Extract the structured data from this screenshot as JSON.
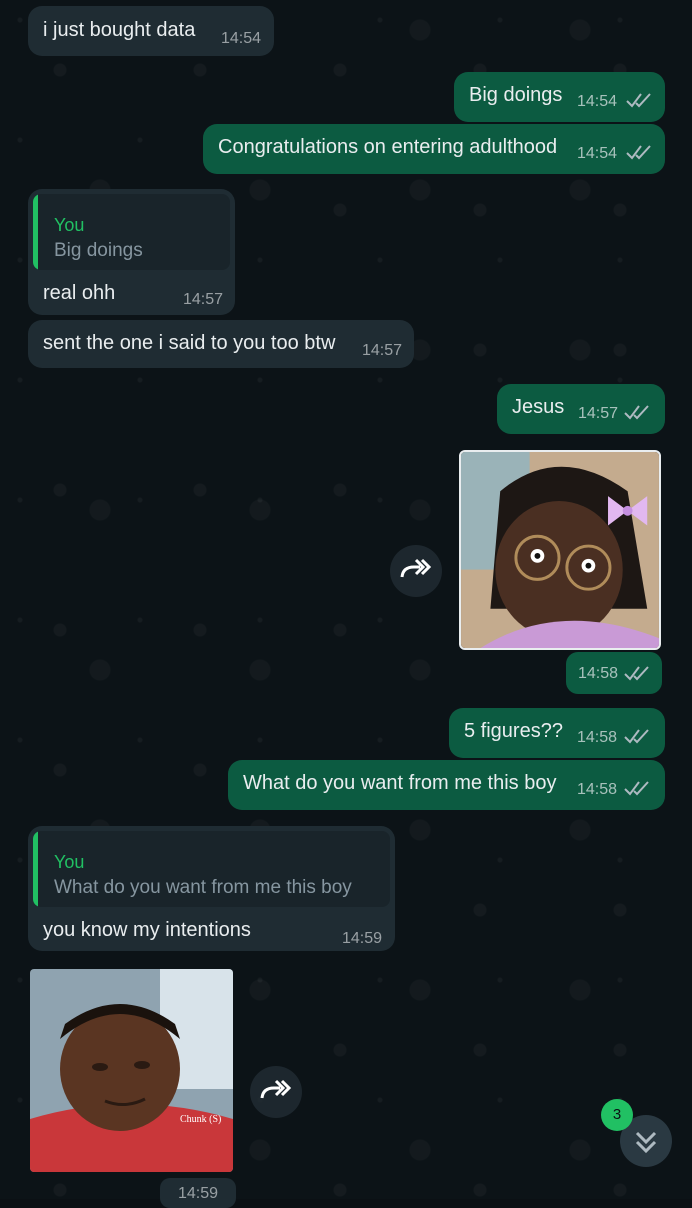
{
  "messages": [
    {
      "dir": "in",
      "text": "i just bought data",
      "time": "14:54"
    },
    {
      "dir": "out",
      "text": "Big doings",
      "time": "14:54"
    },
    {
      "dir": "out",
      "text": "Congratulations on entering adulthood",
      "time": "14:54"
    },
    {
      "dir": "in",
      "quote_author": "You",
      "quote_text": "Big doings",
      "text": "real ohh",
      "time": "14:57"
    },
    {
      "dir": "in",
      "text": "sent the one i said to you too btw",
      "time": "14:57"
    },
    {
      "dir": "out",
      "text": "Jesus",
      "time": "14:57"
    },
    {
      "dir": "out",
      "type": "image",
      "image_desc": "girl-with-glasses-meme",
      "time": "14:58"
    },
    {
      "dir": "out",
      "text": "5 figures??",
      "time": "14:58"
    },
    {
      "dir": "out",
      "text": "What do you want from me this boy",
      "time": "14:58"
    },
    {
      "dir": "in",
      "quote_author": "You",
      "quote_text": "What do you want from me this boy",
      "text": "you know my intentions",
      "time": "14:59"
    },
    {
      "dir": "in",
      "type": "image",
      "image_desc": "boy-meme",
      "image_caption": "Chunk (S)",
      "time": "14:59"
    }
  ],
  "unread_count": "3",
  "colors": {
    "incoming": "#1f2c33",
    "outgoing": "#0c5b41",
    "accent": "#21c063",
    "ticks": "#8696a0"
  },
  "icons": {
    "forward": "forward-icon",
    "read": "double-check-icon",
    "scroll_down": "chevrons-down-icon"
  }
}
